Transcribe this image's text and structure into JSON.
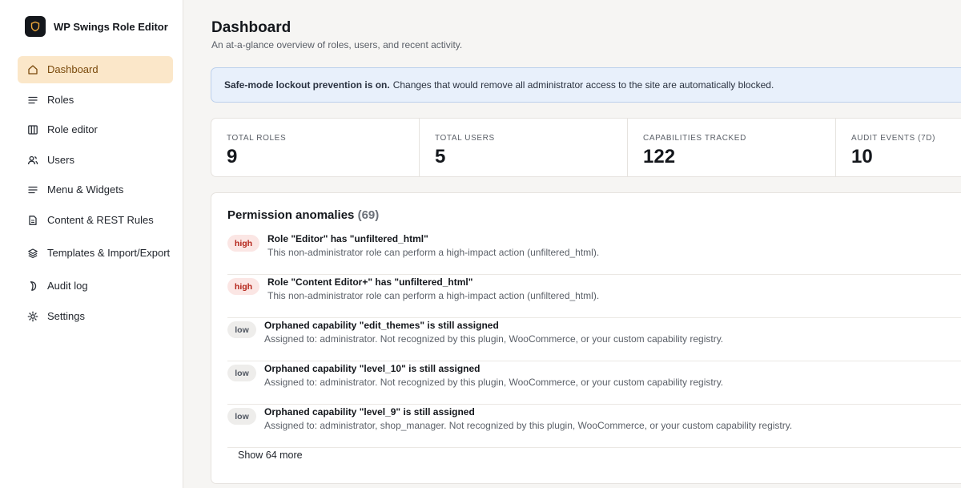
{
  "brand": {
    "name": "WP Swings Role Editor",
    "logo_icon": "shield-icon"
  },
  "sidebar": {
    "items": [
      {
        "label": "Dashboard",
        "icon": "home-icon",
        "active": true
      },
      {
        "label": "Roles",
        "icon": "list-icon"
      },
      {
        "label": "Role editor",
        "icon": "columns-icon"
      },
      {
        "label": "Users",
        "icon": "users-icon"
      },
      {
        "label": "Menu & Widgets",
        "icon": "menu-icon"
      },
      {
        "label": "Content & REST Rules",
        "icon": "document-icon"
      },
      {
        "label": "Templates & Import/Export",
        "icon": "layers-icon"
      },
      {
        "label": "Audit log",
        "icon": "audit-icon"
      },
      {
        "label": "Settings",
        "icon": "gear-icon"
      }
    ]
  },
  "header": {
    "title": "Dashboard",
    "subtitle": "An at-a-glance overview of roles, users, and recent activity."
  },
  "notice": {
    "bold": "Safe-mode lockout prevention is on.",
    "text": "Changes that would remove all administrator access to the site are automatically blocked."
  },
  "stats": [
    {
      "label": "Total roles",
      "value": "9"
    },
    {
      "label": "Total users",
      "value": "5"
    },
    {
      "label": "Capabilities tracked",
      "value": "122"
    },
    {
      "label": "Audit events (7d)",
      "value": "10"
    }
  ],
  "anomalies": {
    "title": "Permission anomalies",
    "count": "(69)",
    "items": [
      {
        "severity": "high",
        "title": "Role \"Editor\" has \"unfiltered_html\"",
        "description": "This non-administrator role can perform a high-impact action (unfiltered_html)."
      },
      {
        "severity": "high",
        "title": "Role \"Content Editor+\" has \"unfiltered_html\"",
        "description": "This non-administrator role can perform a high-impact action (unfiltered_html)."
      },
      {
        "severity": "low",
        "title": "Orphaned capability \"edit_themes\" is still assigned",
        "description": "Assigned to: administrator. Not recognized by this plugin, WooCommerce, or your custom capability registry."
      },
      {
        "severity": "low",
        "title": "Orphaned capability \"level_10\" is still assigned",
        "description": "Assigned to: administrator. Not recognized by this plugin, WooCommerce, or your custom capability registry."
      },
      {
        "severity": "low",
        "title": "Orphaned capability \"level_9\" is still assigned",
        "description": "Assigned to: administrator, shop_manager. Not recognized by this plugin, WooCommerce, or your custom capability registry."
      }
    ],
    "show_more": "Show 64 more"
  },
  "colors": {
    "active_nav_bg": "#fbe7c9",
    "notice_bg": "#e8f0fb",
    "high_badge": "#b42318",
    "brand_dark": "#14171c"
  }
}
